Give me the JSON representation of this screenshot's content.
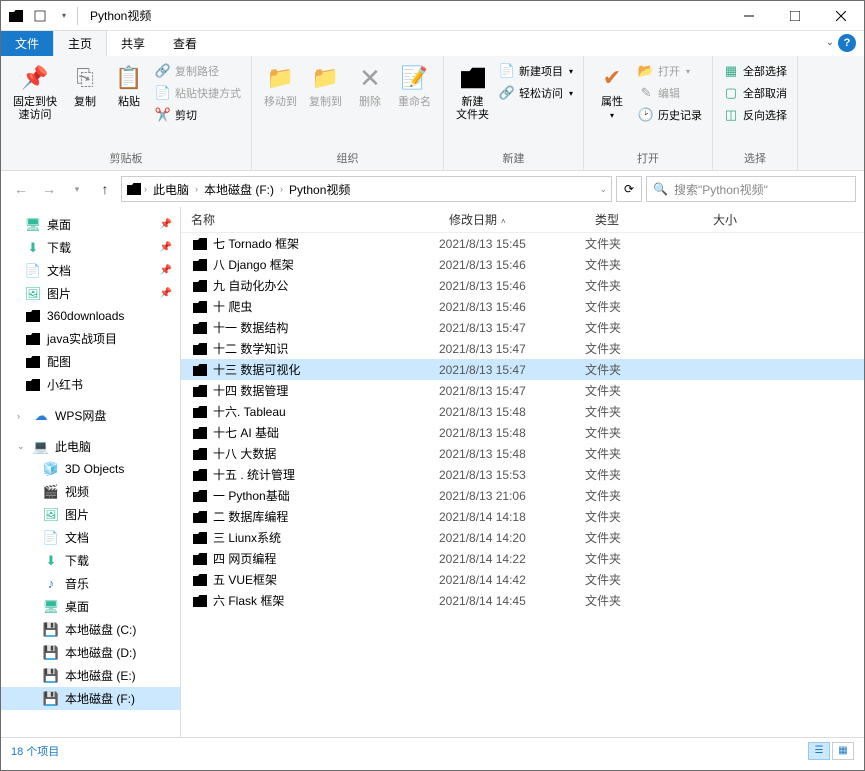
{
  "title": "Python视频",
  "tabs": {
    "file": "文件",
    "home": "主页",
    "share": "共享",
    "view": "查看"
  },
  "ribbon": {
    "pin": "固定到快\n速访问",
    "copy": "复制",
    "paste": "粘贴",
    "copy_path": "复制路径",
    "paste_shortcut": "粘贴快捷方式",
    "cut": "剪切",
    "clipboard_label": "剪贴板",
    "move_to": "移动到",
    "copy_to": "复制到",
    "delete": "删除",
    "rename": "重命名",
    "organize_label": "组织",
    "new_folder": "新建\n文件夹",
    "new_item": "新建项目",
    "easy_access": "轻松访问",
    "new_label": "新建",
    "properties": "属性",
    "open": "打开",
    "edit": "编辑",
    "history": "历史记录",
    "open_label": "打开",
    "select_all": "全部选择",
    "select_none": "全部取消",
    "invert": "反向选择",
    "select_label": "选择"
  },
  "breadcrumb": {
    "this_pc": "此电脑",
    "drive": "本地磁盘 (F:)",
    "folder": "Python视频"
  },
  "search_placeholder": "搜索\"Python视频\"",
  "nav": {
    "desktop": "桌面",
    "downloads": "下载",
    "documents": "文档",
    "pictures": "图片",
    "n360": "360downloads",
    "java": "java实战项目",
    "peitu": "配图",
    "xiaohongshu": "小红书",
    "wps": "WPS网盘",
    "this_pc": "此电脑",
    "objects3d": "3D Objects",
    "videos": "视频",
    "pictures2": "图片",
    "documents2": "文档",
    "downloads2": "下载",
    "music": "音乐",
    "desktop2": "桌面",
    "drive_c": "本地磁盘 (C:)",
    "drive_d": "本地磁盘 (D:)",
    "drive_e": "本地磁盘 (E:)",
    "drive_f": "本地磁盘 (F:)"
  },
  "columns": {
    "name": "名称",
    "date": "修改日期",
    "type": "类型",
    "size": "大小"
  },
  "files": [
    {
      "name": "七 Tornado 框架",
      "date": "2021/8/13 15:45",
      "type": "文件夹"
    },
    {
      "name": "八 Django 框架",
      "date": "2021/8/13 15:46",
      "type": "文件夹"
    },
    {
      "name": "九 自动化办公",
      "date": "2021/8/13 15:46",
      "type": "文件夹"
    },
    {
      "name": "十 爬虫",
      "date": "2021/8/13 15:46",
      "type": "文件夹"
    },
    {
      "name": "十一   数据结构",
      "date": "2021/8/13 15:47",
      "type": "文件夹"
    },
    {
      "name": "十二   数学知识",
      "date": "2021/8/13 15:47",
      "type": "文件夹"
    },
    {
      "name": "十三   数据可视化",
      "date": "2021/8/13 15:47",
      "type": "文件夹",
      "selected": true
    },
    {
      "name": "十四 数据管理",
      "date": "2021/8/13 15:47",
      "type": "文件夹"
    },
    {
      "name": "十六.  Tableau",
      "date": "2021/8/13 15:48",
      "type": "文件夹"
    },
    {
      "name": "十七   AI 基础",
      "date": "2021/8/13 15:48",
      "type": "文件夹"
    },
    {
      "name": "十八   大数据",
      "date": "2021/8/13 15:48",
      "type": "文件夹"
    },
    {
      "name": "十五 . 统计管理",
      "date": "2021/8/13 15:53",
      "type": "文件夹"
    },
    {
      "name": "一 Python基础",
      "date": "2021/8/13 21:06",
      "type": "文件夹"
    },
    {
      "name": "二 数据库编程",
      "date": "2021/8/14 14:18",
      "type": "文件夹"
    },
    {
      "name": "三 Liunx系统",
      "date": "2021/8/14 14:20",
      "type": "文件夹"
    },
    {
      "name": "四 网页编程",
      "date": "2021/8/14 14:22",
      "type": "文件夹"
    },
    {
      "name": "五 VUE框架",
      "date": "2021/8/14 14:42",
      "type": "文件夹"
    },
    {
      "name": "六 Flask 框架",
      "date": "2021/8/14 14:45",
      "type": "文件夹"
    }
  ],
  "status": "18 个项目"
}
